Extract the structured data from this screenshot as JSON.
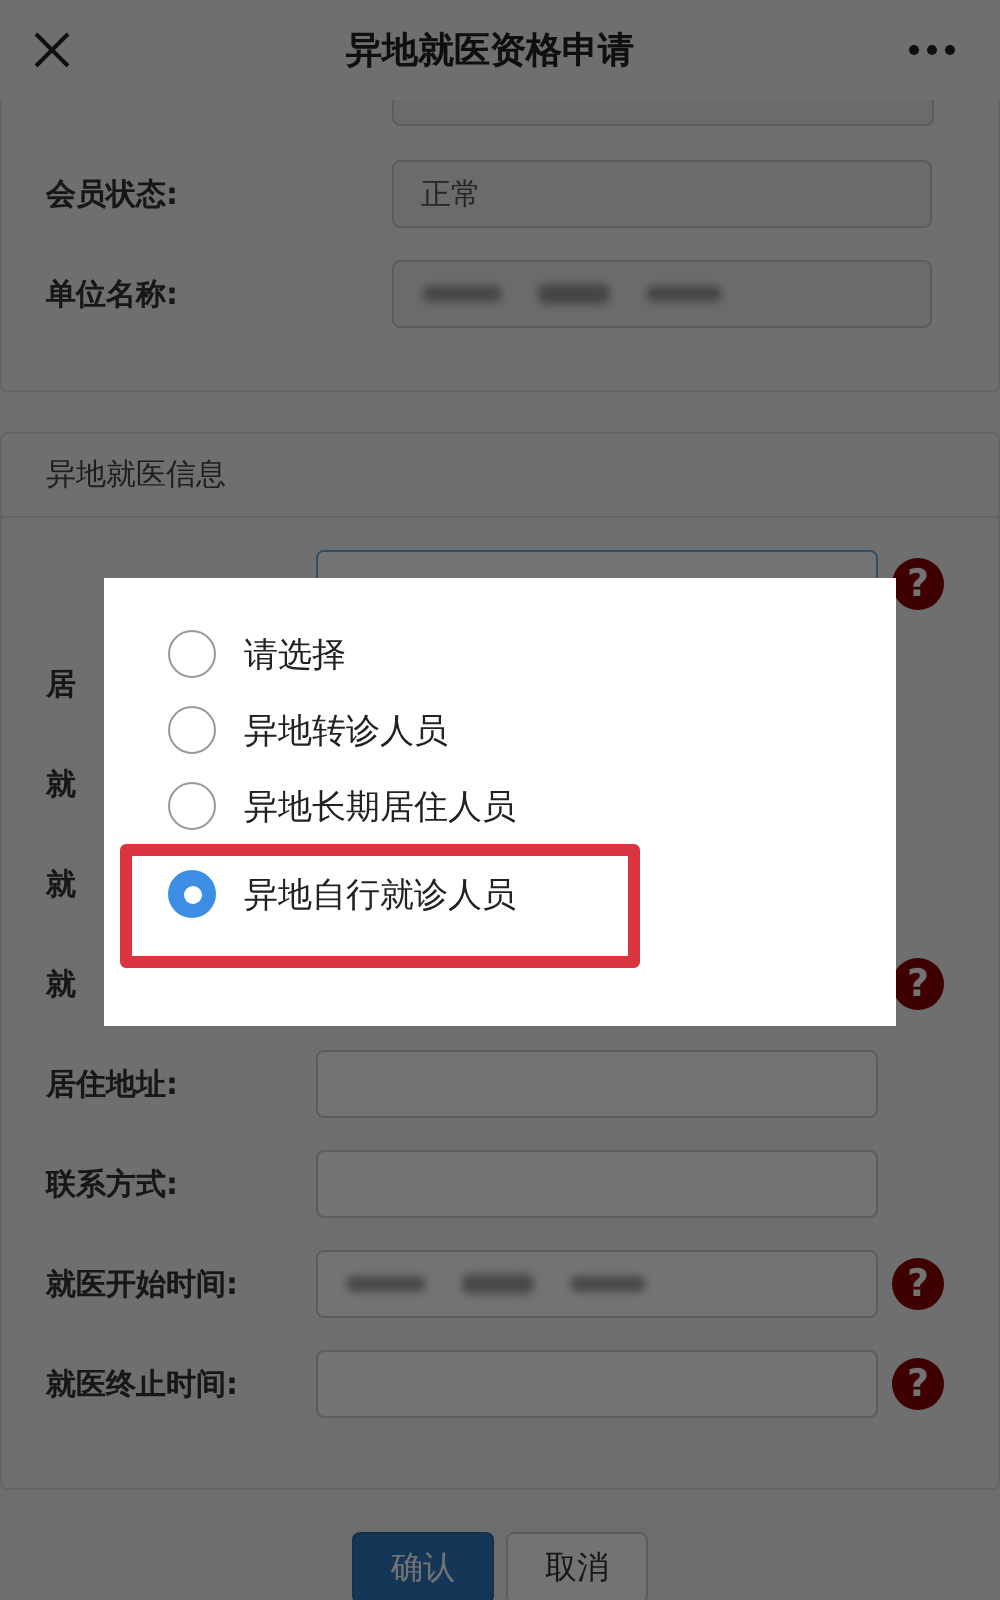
{
  "header": {
    "title": "异地就医资格申请"
  },
  "member_card": {
    "rows": [
      {
        "kind": "blurred_cut"
      },
      {
        "kind": "text",
        "label": "会员状态:",
        "value": "正常"
      },
      {
        "kind": "blurred",
        "label": "单位名称:"
      }
    ]
  },
  "medical_card": {
    "title": "异地就医信息",
    "rows": [
      {
        "kind": "select",
        "focused": true,
        "help": "?"
      },
      {
        "kind": "covered",
        "label": "居"
      },
      {
        "kind": "covered",
        "label": "就"
      },
      {
        "kind": "covered",
        "label": "就"
      },
      {
        "kind": "covered",
        "label": "就",
        "help": "?"
      },
      {
        "kind": "input",
        "label": "居住地址:"
      },
      {
        "kind": "input",
        "label": "联系方式:"
      },
      {
        "kind": "blurred",
        "label": "就医开始时间:",
        "help": "?"
      },
      {
        "kind": "input",
        "label": "就医终止时间:",
        "help": "?"
      }
    ]
  },
  "buttons": [
    {
      "label": "确认",
      "kind": "primary"
    },
    {
      "label": "取消",
      "kind": "default"
    }
  ],
  "dialog": {
    "options": [
      {
        "label": "请选择",
        "selected": false,
        "highlighted": false
      },
      {
        "label": "异地转诊人员",
        "selected": false,
        "highlighted": false
      },
      {
        "label": "异地长期居住人员",
        "selected": false,
        "highlighted": false
      },
      {
        "label": "异地自行就诊人员",
        "selected": true,
        "highlighted": true
      }
    ]
  }
}
